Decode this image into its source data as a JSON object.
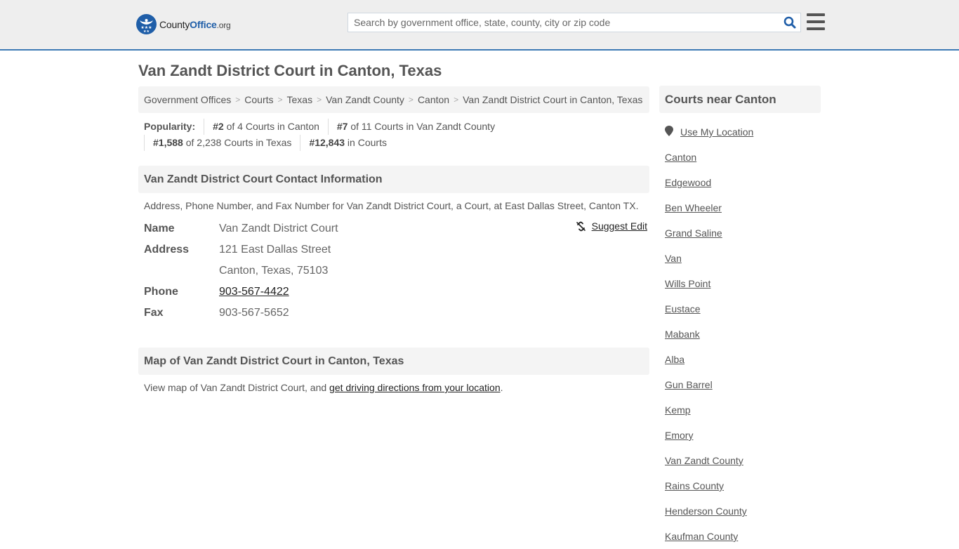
{
  "header": {
    "logo": {
      "part1": "County",
      "part2": "Office",
      "part3": ".org"
    },
    "search": {
      "placeholder": "Search by government office, state, county, city or zip code",
      "value": ""
    },
    "icons": {
      "search": "search-icon",
      "menu": "hamburger-menu-icon"
    }
  },
  "page": {
    "title": "Van Zandt District Court in Canton, Texas"
  },
  "breadcrumb": [
    {
      "label": "Government Offices"
    },
    {
      "label": "Courts"
    },
    {
      "label": "Texas"
    },
    {
      "label": "Van Zandt County"
    },
    {
      "label": "Canton"
    },
    {
      "label": "Van Zandt District Court in Canton, Texas"
    }
  ],
  "popularity": {
    "label": "Popularity:",
    "items": [
      {
        "rank": "#2",
        "text": " of 4 Courts in Canton"
      },
      {
        "rank": "#7",
        "text": " of 11 Courts in Van Zandt County"
      },
      {
        "rank": "#1,588",
        "text": " of 2,238 Courts in Texas"
      },
      {
        "rank": "#12,843",
        "text": " in Courts"
      }
    ]
  },
  "contact": {
    "heading": "Van Zandt District Court Contact Information",
    "description": "Address, Phone Number, and Fax Number for Van Zandt District Court, a Court, at East Dallas Street, Canton TX.",
    "suggest_edit": "Suggest Edit",
    "fields": {
      "name_label": "Name",
      "name_value": "Van Zandt District Court",
      "address_label": "Address",
      "address_line1": "121 East Dallas Street",
      "address_line2": "Canton, Texas, 75103",
      "phone_label": "Phone",
      "phone_value": "903-567-4422",
      "fax_label": "Fax",
      "fax_value": "903-567-5652"
    }
  },
  "map": {
    "heading": "Map of Van Zandt District Court in Canton, Texas",
    "text_before": "View map of Van Zandt District Court, and ",
    "link": "get driving directions from your location",
    "text_after": "."
  },
  "sidebar": {
    "heading": "Courts near Canton",
    "use_location": "Use My Location",
    "items": [
      "Canton",
      "Edgewood",
      "Ben Wheeler",
      "Grand Saline",
      "Van",
      "Wills Point",
      "Eustace",
      "Mabank",
      "Alba",
      "Gun Barrel",
      "Kemp",
      "Emory",
      "Van Zandt County",
      "Rains County",
      "Henderson County",
      "Kaufman County"
    ]
  },
  "colors": {
    "accent": "#3d7ab5",
    "brand": "#1f5ea8",
    "header_bg": "#eeeeee",
    "panel_bg": "#f4f4f4"
  }
}
